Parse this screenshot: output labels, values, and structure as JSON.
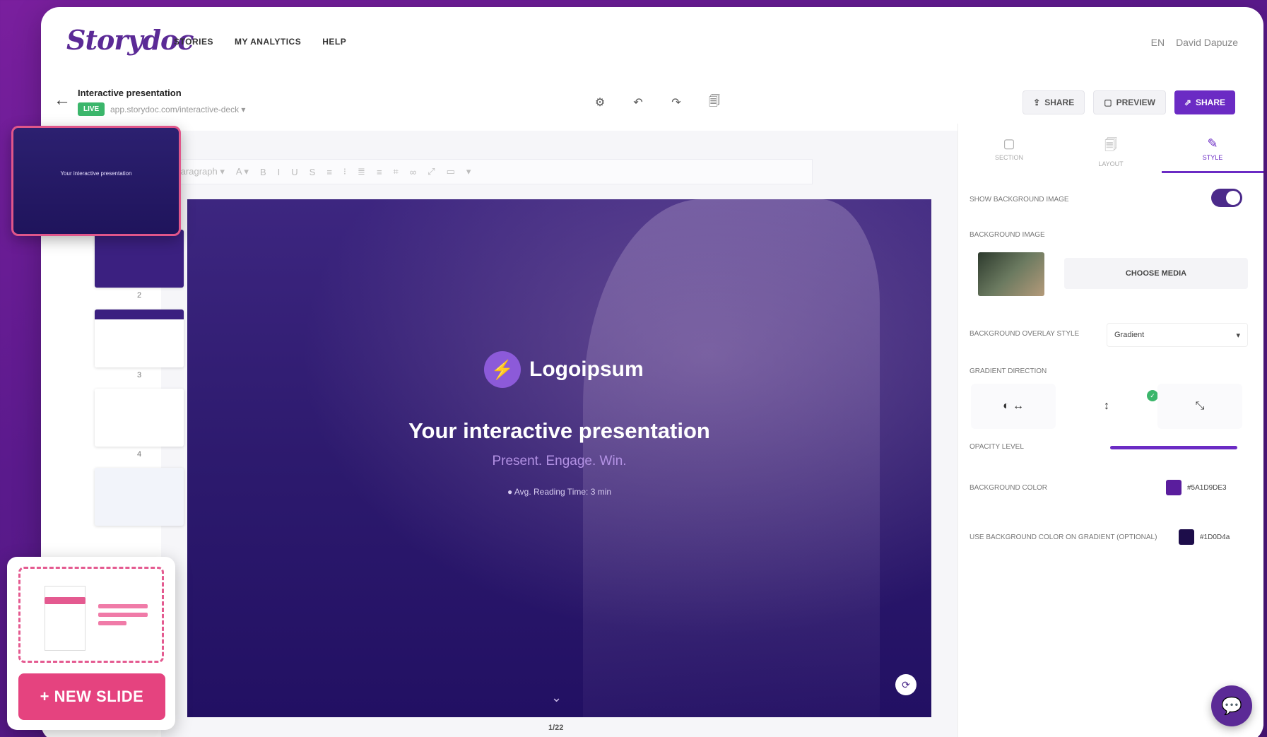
{
  "app": {
    "logo": "Storydoc",
    "nav": [
      "STORIES",
      "MY ANALYTICS",
      "HELP"
    ],
    "nav_right": [
      "EN",
      "David Dapuze"
    ]
  },
  "docbar": {
    "back": "←",
    "title": "Interactive presentation",
    "badge": "LIVE",
    "url": "app.storydoc.com/interactive-deck ▾",
    "tools": [
      "⚙",
      "↶",
      "↷",
      "🗐"
    ],
    "btn_share_label": "SHARE",
    "btn_preview_label": "PREVIEW",
    "btn_primary_label": "SHARE",
    "btn_share_icon": "⇪",
    "btn_preview_icon": "▢",
    "btn_primary_icon": "⇗"
  },
  "format_bar": {
    "paragraph": "Paragraph ▾",
    "items": [
      "A ▾",
      "B",
      "I",
      "U",
      "S",
      "≡",
      "⁝",
      "≣",
      "≡",
      "⌗",
      "∞",
      "⤢",
      "▭",
      "▾"
    ]
  },
  "slide": {
    "logo_mark": "⚡",
    "logo_text": "Logoipsum",
    "title": "Your interactive presentation",
    "subtitle": "Present. Engage. Win.",
    "meta": "● Avg. Reading Time: 3 min",
    "chevron": "⌄",
    "badge": "⟳"
  },
  "page_count": "1/22",
  "thumbs": {
    "active_text": "Your interactive presentation",
    "numbers": [
      "2",
      "3",
      "4"
    ]
  },
  "new_slide": {
    "label": "+ NEW SLIDE"
  },
  "panel": {
    "tabs": [
      {
        "icon": "▢",
        "label": "SECTION"
      },
      {
        "icon": "🗐",
        "label": "LAYOUT"
      },
      {
        "icon": "✎",
        "label": "STYLE"
      }
    ],
    "rows": {
      "background_toggle": "SHOW BACKGROUND IMAGE",
      "background_image": "BACKGROUND IMAGE",
      "choose_media": "CHOOSE MEDIA",
      "overlay_style_label": "BACKGROUND OVERLAY STYLE",
      "overlay_style_value": "Gradient",
      "gradient_direction": "GRADIENT DIRECTION",
      "opacity": "OPACITY LEVEL",
      "bg_color_label": "BACKGROUND COLOR",
      "bg_color_value": "#5A1D9DE3",
      "secondary_color_label": "USE BACKGROUND COLOR ON GRADIENT (OPTIONAL)",
      "secondary_color_value": "#1D0D4a"
    },
    "direction_icons": [
      "◐ ↔",
      "↕",
      "⤡"
    ],
    "direction_badge": "✓"
  },
  "colors": {
    "accent": "#6b2bc4",
    "pink": "#e5437f",
    "swatch_primary": "#5a1d9d",
    "swatch_secondary": "#1d0d4a"
  },
  "chat": {
    "icon": "💬"
  }
}
